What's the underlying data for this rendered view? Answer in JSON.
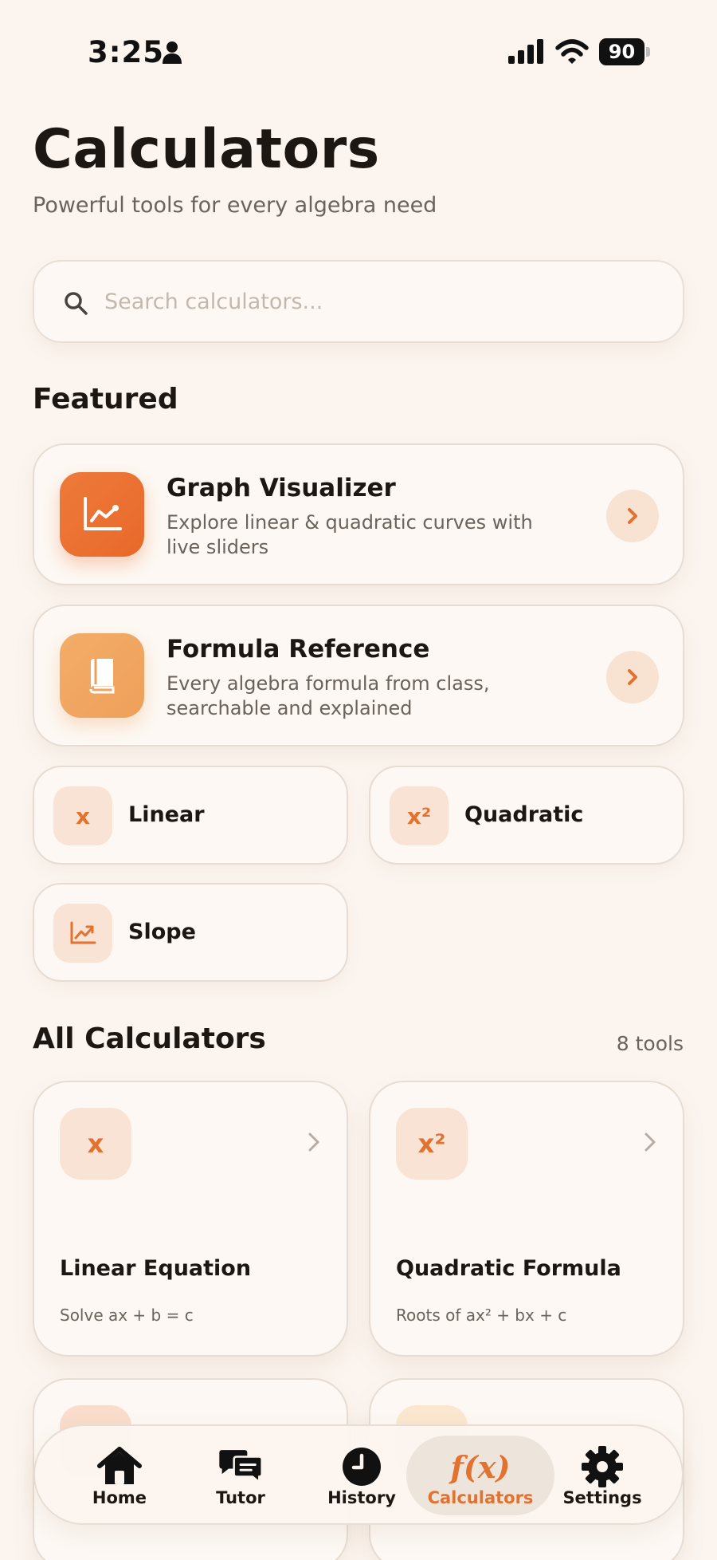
{
  "status_bar": {
    "time": "3:25",
    "battery": "90"
  },
  "header": {
    "title": "Calculators",
    "subtitle": "Powerful tools for every algebra need"
  },
  "search": {
    "placeholder": "Search calculators...",
    "value": ""
  },
  "featured": {
    "title": "Featured",
    "cards": [
      {
        "title": "Graph Visualizer",
        "description": "Explore linear & quadratic curves with live sliders",
        "icon": "chart-line-icon",
        "color": "#ea7533"
      },
      {
        "title": "Formula Reference",
        "description": "Every algebra formula from class, searchable and explained",
        "icon": "book-icon",
        "color": "#f0a25c"
      }
    ],
    "quick": [
      {
        "label": "Linear",
        "glyph": "x"
      },
      {
        "label": "Quadratic",
        "glyph": "x²"
      },
      {
        "label": "Slope",
        "icon": "trend-up-icon"
      }
    ]
  },
  "all_calculators": {
    "title": "All Calculators",
    "count": "8 tools",
    "cards": [
      {
        "glyph": "x",
        "title": "Linear Equation",
        "description": "Solve ax + b = c"
      },
      {
        "glyph": "x²",
        "title": "Quadratic Formula",
        "description": "Roots of ax² + bx + c"
      }
    ]
  },
  "nav": {
    "items": [
      {
        "label": "Home",
        "icon": "home-icon"
      },
      {
        "label": "Tutor",
        "icon": "chat-icon"
      },
      {
        "label": "History",
        "icon": "clock-icon"
      },
      {
        "label": "Calculators",
        "icon": "function-icon",
        "glyph": "f(x)",
        "active": true
      },
      {
        "label": "Settings",
        "icon": "gear-icon"
      }
    ]
  },
  "colors": {
    "accent": "#e2722f",
    "background": "#fcf5ef"
  }
}
